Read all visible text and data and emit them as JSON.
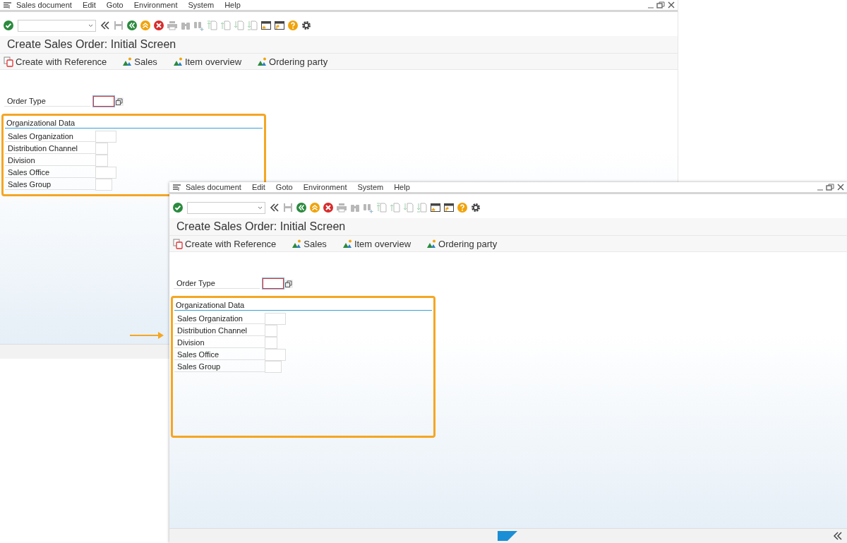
{
  "windows": [
    {
      "menu": [
        "Sales document",
        "Edit",
        "Goto",
        "Environment",
        "System",
        "Help"
      ],
      "toolbar": [
        {
          "kind": "enter",
          "disabled": false
        },
        {
          "kind": "command",
          "disabled": false
        },
        {
          "kind": "collapse",
          "disabled": false
        },
        {
          "kind": "save",
          "disabled": true
        },
        {
          "kind": "back",
          "disabled": false
        },
        {
          "kind": "exit",
          "disabled": false
        },
        {
          "kind": "cancel",
          "disabled": false
        },
        {
          "kind": "print",
          "disabled": true
        },
        {
          "kind": "find",
          "disabled": true
        },
        {
          "kind": "findnext",
          "disabled": true
        },
        {
          "kind": "first",
          "disabled": true
        },
        {
          "kind": "prev",
          "disabled": true
        },
        {
          "kind": "next",
          "disabled": true
        },
        {
          "kind": "last",
          "disabled": true
        },
        {
          "kind": "session",
          "disabled": false
        },
        {
          "kind": "shortcut",
          "disabled": false
        },
        {
          "kind": "help",
          "disabled": false
        },
        {
          "kind": "settings",
          "disabled": false
        }
      ],
      "title": "Create Sales Order: Initial Screen",
      "actions": [
        {
          "kind": "reference",
          "label": "Create with Reference"
        },
        {
          "kind": "overview",
          "label": "Sales"
        },
        {
          "kind": "overview",
          "label": "Item overview"
        },
        {
          "kind": "overview",
          "label": "Ordering party"
        }
      ],
      "order_type": {
        "label": "Order Type",
        "required": true
      },
      "group": {
        "title": "Organizational Data",
        "highlighted": true,
        "fields": [
          {
            "label": "Sales Organization"
          },
          {
            "label": "Distribution Channel"
          },
          {
            "label": "Division"
          },
          {
            "label": "Sales Office"
          },
          {
            "label": "Sales Group"
          }
        ]
      }
    },
    {
      "menu": [
        "Sales document",
        "Edit",
        "Goto",
        "Environment",
        "System",
        "Help"
      ],
      "toolbar": [
        {
          "kind": "enter",
          "disabled": false
        },
        {
          "kind": "command",
          "disabled": false
        },
        {
          "kind": "collapse",
          "disabled": false
        },
        {
          "kind": "save",
          "disabled": true
        },
        {
          "kind": "back",
          "disabled": false
        },
        {
          "kind": "exit",
          "disabled": false
        },
        {
          "kind": "cancel",
          "disabled": false
        },
        {
          "kind": "print",
          "disabled": true
        },
        {
          "kind": "find",
          "disabled": true
        },
        {
          "kind": "findnext",
          "disabled": true
        },
        {
          "kind": "first",
          "disabled": true
        },
        {
          "kind": "prev",
          "disabled": true
        },
        {
          "kind": "next",
          "disabled": true
        },
        {
          "kind": "last",
          "disabled": true
        },
        {
          "kind": "session",
          "disabled": false
        },
        {
          "kind": "shortcut",
          "disabled": false
        },
        {
          "kind": "help",
          "disabled": false
        },
        {
          "kind": "settings",
          "disabled": false
        }
      ],
      "title": "Create Sales Order: Initial Screen",
      "actions": [
        {
          "kind": "reference",
          "label": "Create with Reference"
        },
        {
          "kind": "overview",
          "label": "Sales"
        },
        {
          "kind": "overview",
          "label": "Item overview"
        },
        {
          "kind": "overview",
          "label": "Ordering party"
        }
      ],
      "order_type": {
        "label": "Order Type",
        "required": true
      },
      "group": {
        "title": "Organizational Data",
        "highlighted": true,
        "fields": [
          {
            "label": "Sales Organization"
          },
          {
            "label": "Distribution Channel"
          },
          {
            "label": "Division"
          },
          {
            "label": "Sales Office"
          },
          {
            "label": "Sales Group"
          }
        ]
      }
    }
  ]
}
